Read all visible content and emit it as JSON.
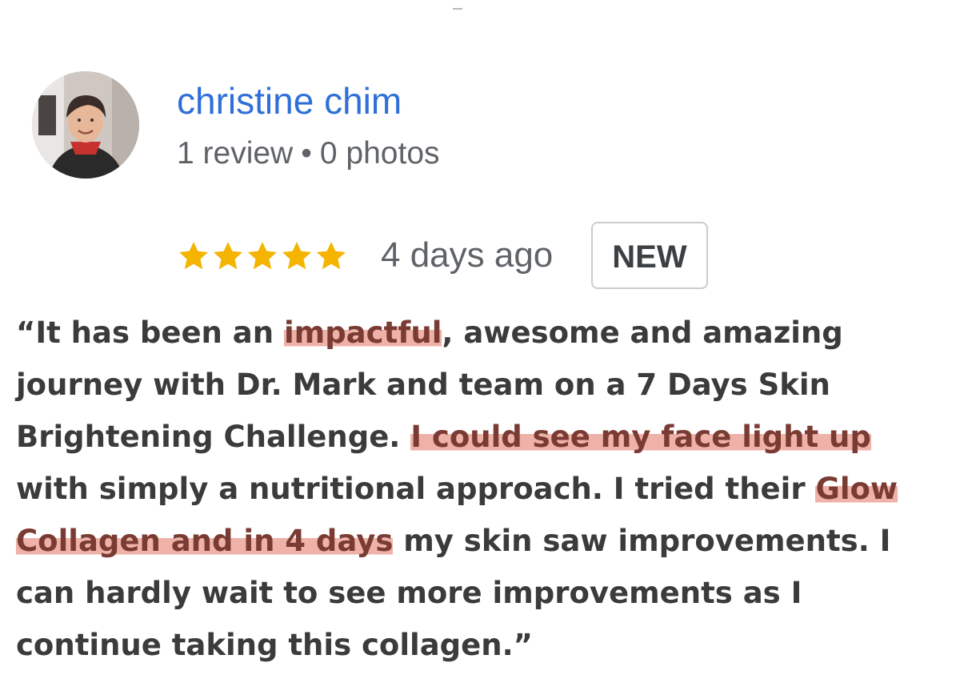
{
  "reviewer": {
    "name": "christine chim",
    "review_count": "1 review",
    "separator": "•",
    "photo_count": "0 photos",
    "avatar_icon": "user-photo-avatar"
  },
  "rating": {
    "stars": 5,
    "max": 5,
    "star_color": "#F4B400",
    "date": "4 days ago",
    "badge": "NEW"
  },
  "review": {
    "segments": [
      {
        "text": "“It has been an ",
        "highlight": false
      },
      {
        "text": "impactful",
        "highlight": true
      },
      {
        "text": ", awesome and amazing journey with Dr. Mark and team on a 7 Days Skin Brightening Challenge. ",
        "highlight": false
      },
      {
        "text": "I could see my face light up",
        "highlight": true
      },
      {
        "text": " with simply a nutritional approach. I tried their ",
        "highlight": false
      },
      {
        "text": "Glow Collagen and in 4 days",
        "highlight": true
      },
      {
        "text": " my skin saw improvements. I can hardly wait to see more improvements as I continue taking this collagen.”",
        "highlight": false
      }
    ],
    "highlight_color": "#E27A69"
  },
  "colors": {
    "name_link": "#2F6FD8",
    "meta_text": "#5F6368",
    "body_text": "#3B3B3B"
  }
}
